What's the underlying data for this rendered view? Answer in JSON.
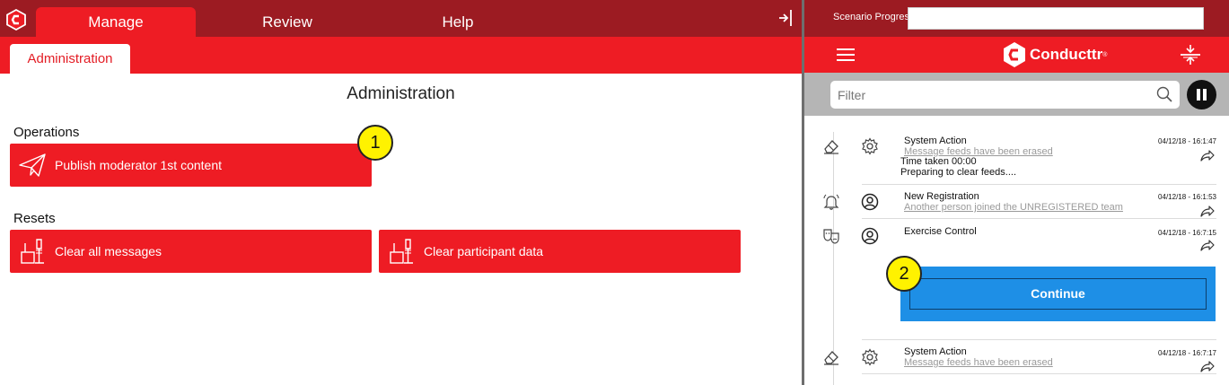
{
  "tabs": {
    "manage": "Manage",
    "review": "Review",
    "help": "Help"
  },
  "subtab": "Administration",
  "page_title": "Administration",
  "sections": {
    "operations": "Operations",
    "resets": "Resets"
  },
  "buttons": {
    "publish": "Publish moderator 1st content",
    "clear_messages": "Clear all messages",
    "clear_participant": "Clear participant data"
  },
  "callouts": {
    "one": "1",
    "two": "2"
  },
  "right_panel": {
    "progress_label": "Scenario Progress",
    "progress_value": 0,
    "brand": "Conducttr",
    "brand_mark": "®",
    "filter_placeholder": "Filter",
    "feed": [
      {
        "type_icon": "eraser-icon",
        "avatar_icon": "gear-icon",
        "title": "System Action",
        "subtitle": "Message feeds have been erased",
        "time": "04/12/18 - 16:1:47",
        "body": [
          "Time taken 00:00",
          "Preparing to clear feeds...."
        ]
      },
      {
        "type_icon": "bell-icon",
        "avatar_icon": "user-icon",
        "title": "New Registration",
        "subtitle": "Another person joined the UNREGISTERED team",
        "time": "04/12/18 - 16:1:53"
      },
      {
        "type_icon": "theatre-masks-icon",
        "avatar_icon": "user-icon",
        "title": "Exercise Control",
        "time": "04/12/18 - 16:7:15",
        "action": "Continue"
      },
      {
        "type_icon": "eraser-icon",
        "avatar_icon": "gear-icon",
        "title": "System Action",
        "subtitle": "Message feeds have been erased",
        "time": "04/12/18 - 16:7:17"
      }
    ]
  },
  "colors": {
    "dark_red": "#9c1b22",
    "red": "#ee1c24",
    "blue": "#1e8fe6",
    "callout_yellow": "#fff200"
  }
}
